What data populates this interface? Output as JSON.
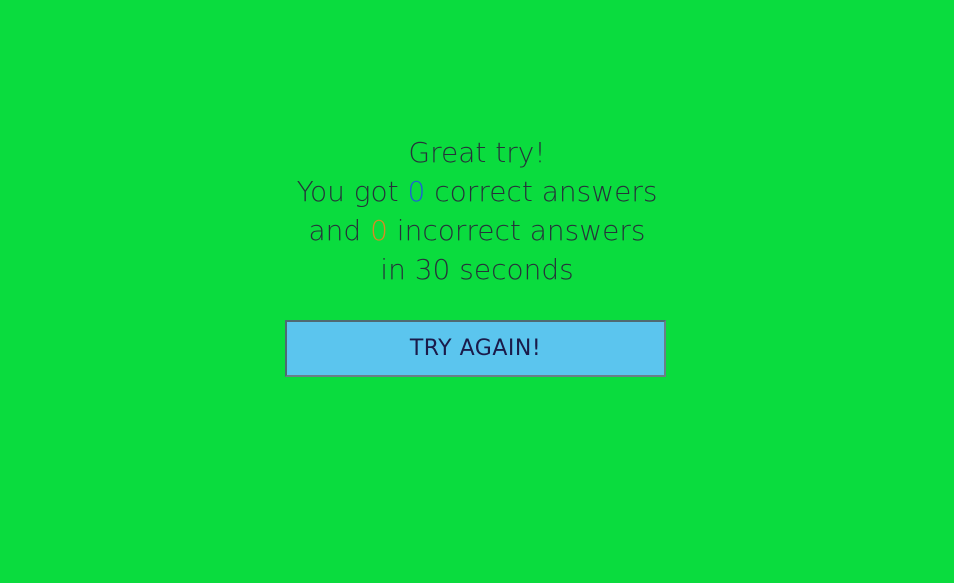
{
  "result": {
    "heading": "Great try!",
    "correct_prefix": "You got ",
    "correct_count": "0",
    "correct_suffix": " correct answers",
    "incorrect_prefix": "and ",
    "incorrect_count": "0",
    "incorrect_suffix": " incorrect answers",
    "time_text": "in 30 seconds"
  },
  "actions": {
    "try_again_label": "TRY AGAIN!"
  },
  "colors": {
    "background": "#0adc3e",
    "correct_count": "#1f5fd6",
    "incorrect_count": "#d78a24",
    "button": "#5bc5ee"
  }
}
